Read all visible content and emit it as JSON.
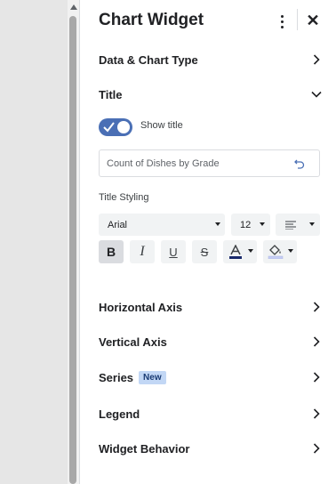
{
  "panel": {
    "title": "Chart Widget",
    "menu_icon": "more-vert-icon",
    "close_icon": "close-icon"
  },
  "sections": {
    "data_chart_type": "Data & Chart Type",
    "title": "Title",
    "horizontal_axis": "Horizontal Axis",
    "vertical_axis": "Vertical Axis",
    "series": "Series",
    "series_badge": "New",
    "legend": "Legend",
    "widget_behavior": "Widget Behavior"
  },
  "title_section": {
    "show_title_label": "Show title",
    "show_title_enabled": true,
    "title_value": "Count of Dishes by Grade",
    "styling_label": "Title Styling",
    "font_family": "Arial",
    "font_size": "12",
    "bold_active": true,
    "text_color": "#1a2a6c",
    "fill_color": "#c5cdf5"
  },
  "colors": {
    "accent": "#4a6fb5",
    "badge_bg": "#c2d7f5"
  }
}
